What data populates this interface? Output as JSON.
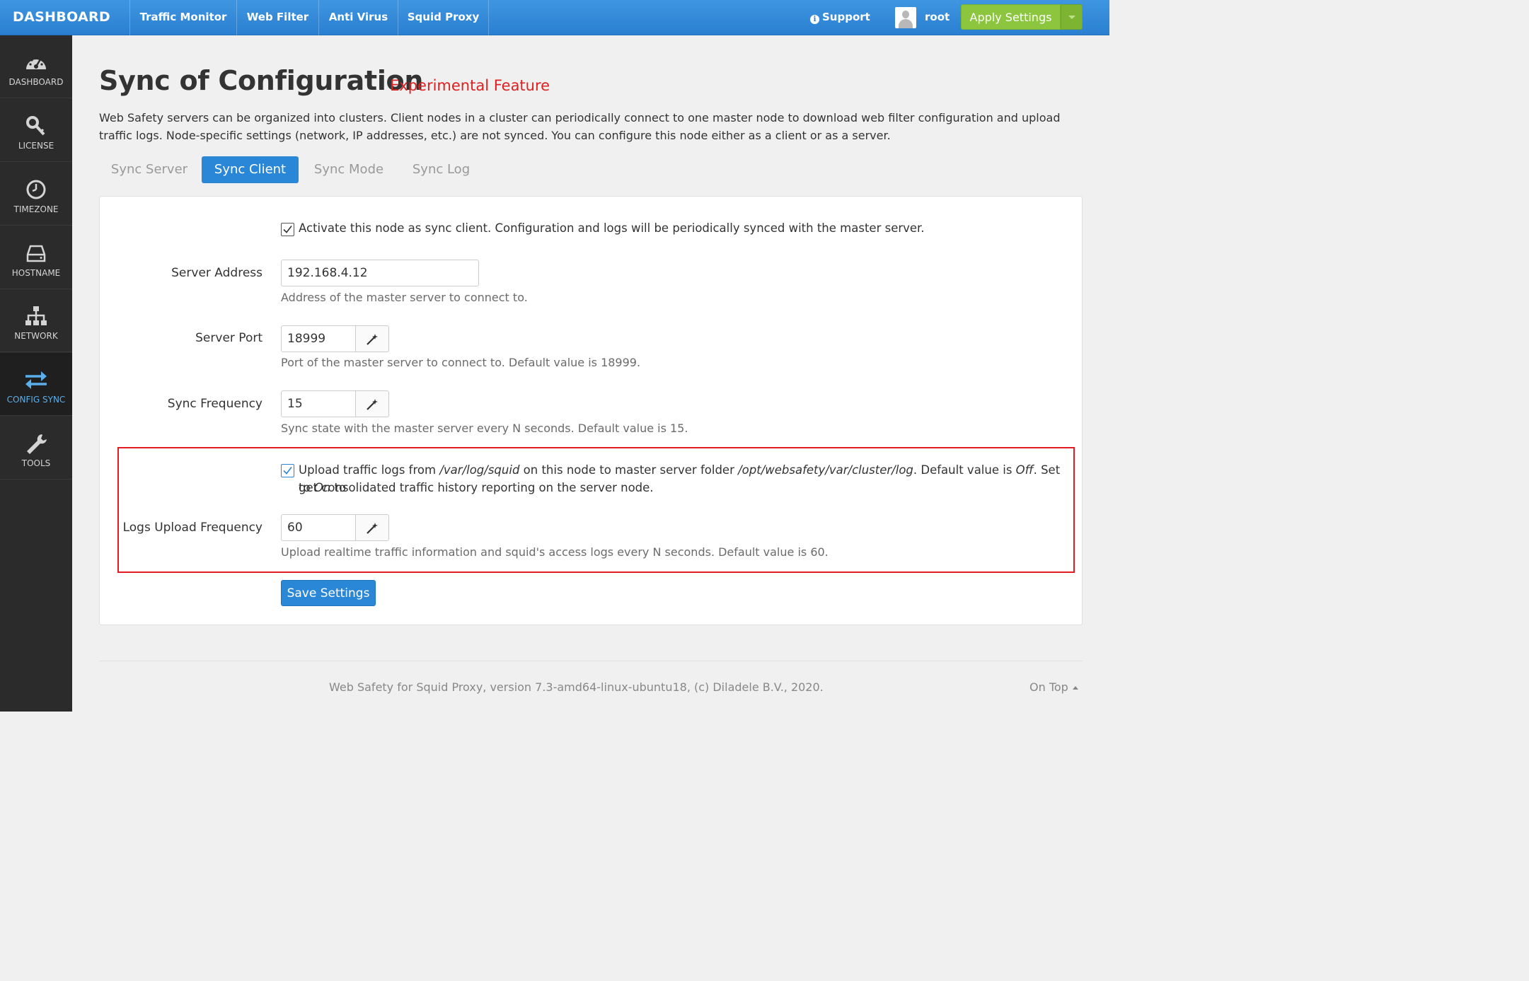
{
  "topbar": {
    "brand": "DASHBOARD",
    "nav": [
      "Traffic Monitor",
      "Web Filter",
      "Anti Virus",
      "Squid Proxy"
    ],
    "support": "Support",
    "user": "root",
    "apply": "Apply Settings",
    "accent": "#2a7fd1",
    "apply_color": "#8cc63f"
  },
  "sidebar": {
    "items": [
      {
        "label": "DASHBOARD",
        "icon": "speedometer-icon"
      },
      {
        "label": "LICENSE",
        "icon": "key-icon"
      },
      {
        "label": "TIMEZONE",
        "icon": "clock-icon"
      },
      {
        "label": "HOSTNAME",
        "icon": "hard-drive-icon"
      },
      {
        "label": "NETWORK",
        "icon": "network-icon"
      },
      {
        "label": "CONFIG SYNC",
        "icon": "sync-arrows-icon",
        "active": true
      },
      {
        "label": "TOOLS",
        "icon": "wrench-icon"
      }
    ]
  },
  "page": {
    "title": "Sync of Configuration",
    "subtitle": "Experimental Feature",
    "intro": "Web Safety servers can be organized into clusters. Client nodes in a cluster can periodically connect to one master node to download web filter configuration and upload traffic logs. Node-specific settings (network, IP addresses, etc.) are not synced. You can configure this node either as a client or as a server.",
    "tabs": [
      {
        "label": "Sync Server"
      },
      {
        "label": "Sync Client",
        "active": true
      },
      {
        "label": "Sync Mode"
      },
      {
        "label": "Sync Log"
      }
    ]
  },
  "form": {
    "activate": {
      "checked": true,
      "text": "Activate this node as sync client. Configuration and logs will be periodically synced with the master server."
    },
    "server_address": {
      "label": "Server Address",
      "value": "192.168.4.12",
      "help": "Address of the master server to connect to."
    },
    "server_port": {
      "label": "Server Port",
      "value": "18999",
      "help": "Port of the master server to connect to. Default value is 18999."
    },
    "sync_frequency": {
      "label": "Sync Frequency",
      "value": "15",
      "help": "Sync state with the master server every N seconds. Default value is 15."
    },
    "upload_logs": {
      "checked": true,
      "t1": "Upload traffic logs from ",
      "path1": "/var/log/squid",
      "t2": " on this node to master server folder ",
      "path2": "/opt/websafety/var/cluster/log",
      "t3": ". Default value is ",
      "off": "Off",
      "t4": ". Set to ",
      "on": "On",
      "t5": " to",
      "line2": "get consolidated traffic history reporting on the server node."
    },
    "logs_upload_frequency": {
      "label": "Logs Upload Frequency",
      "value": "60",
      "help": "Upload realtime traffic information and squid's access logs every N seconds. Default value is 60."
    },
    "save": "Save Settings"
  },
  "footer": {
    "text": "Web Safety for Squid Proxy, version 7.3-amd64-linux-ubuntu18, (c) Diladele B.V., 2020.",
    "on_top": "On Top"
  }
}
